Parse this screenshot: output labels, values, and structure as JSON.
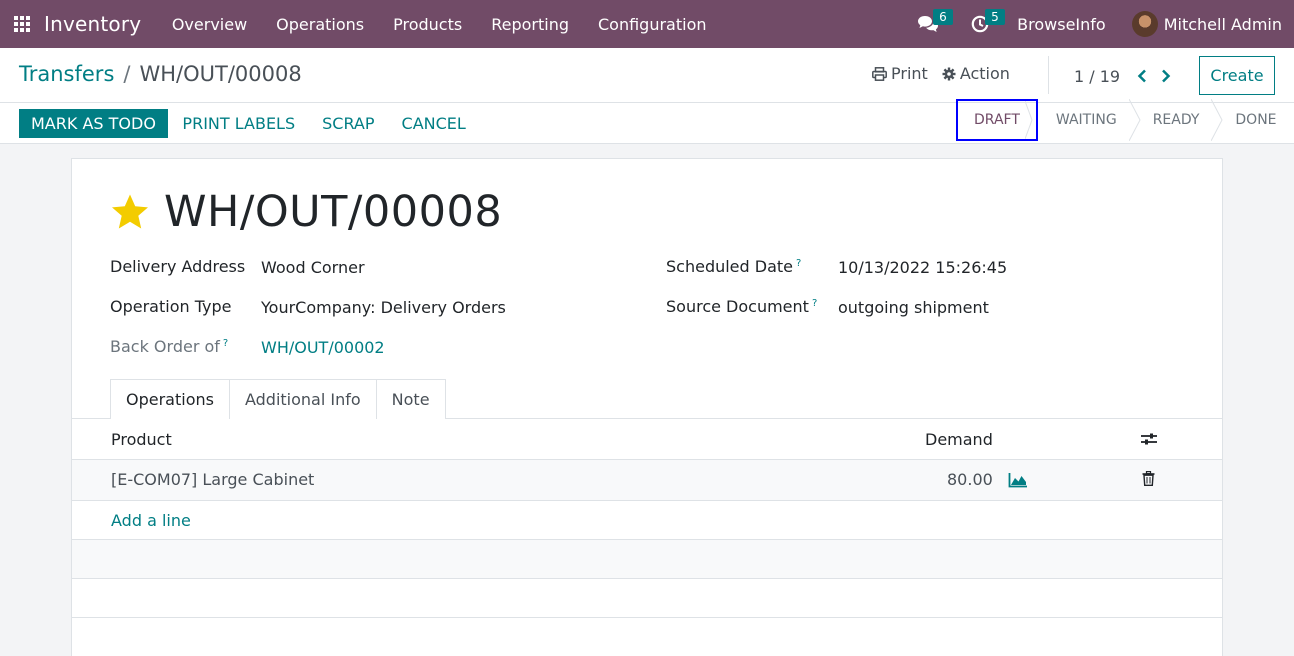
{
  "navbar": {
    "app_name": "Inventory",
    "apps_icon": "grid-icon",
    "menu": [
      "Overview",
      "Operations",
      "Products",
      "Reporting",
      "Configuration"
    ],
    "messages_badge": "6",
    "activities_badge": "5",
    "company": "BrowseInfo",
    "user": "Mitchell Admin",
    "bg_color": "#714b67"
  },
  "breadcrumb": {
    "parent": "Transfers",
    "separator": "/",
    "current": "WH/OUT/00008"
  },
  "control": {
    "print_label": "Print",
    "action_label": "Action",
    "pager": "1 / 19",
    "create_label": "Create"
  },
  "buttons": {
    "mark_as_todo": "MARK AS TODO",
    "print_labels": "PRINT LABELS",
    "scrap": "SCRAP",
    "cancel": "CANCEL"
  },
  "statusbar": {
    "stages": [
      "DRAFT",
      "WAITING",
      "READY",
      "DONE"
    ],
    "active": "DRAFT"
  },
  "record": {
    "title": "WH/OUT/00008",
    "starred": true,
    "fields": {
      "delivery_address_label": "Delivery Address",
      "delivery_address": "Wood Corner",
      "operation_type_label": "Operation Type",
      "operation_type": "YourCompany: Delivery Orders",
      "back_order_label": "Back Order of",
      "back_order": "WH/OUT/00002",
      "scheduled_date_label": "Scheduled Date",
      "scheduled_date": "10/13/2022 15:26:45",
      "source_document_label": "Source Document",
      "source_document": "outgoing shipment",
      "help_mark": "?"
    }
  },
  "tabs": [
    "Operations",
    "Additional Info",
    "Note"
  ],
  "table": {
    "columns": [
      "Product",
      "Demand"
    ],
    "rows": [
      {
        "product": "[E-COM07] Large Cabinet",
        "demand": "80.00"
      }
    ],
    "add_line": "Add a line"
  },
  "colors": {
    "accent": "#017e84",
    "brand": "#714b67",
    "highlight_border": "#0000ff",
    "star": "#f3cc00"
  }
}
